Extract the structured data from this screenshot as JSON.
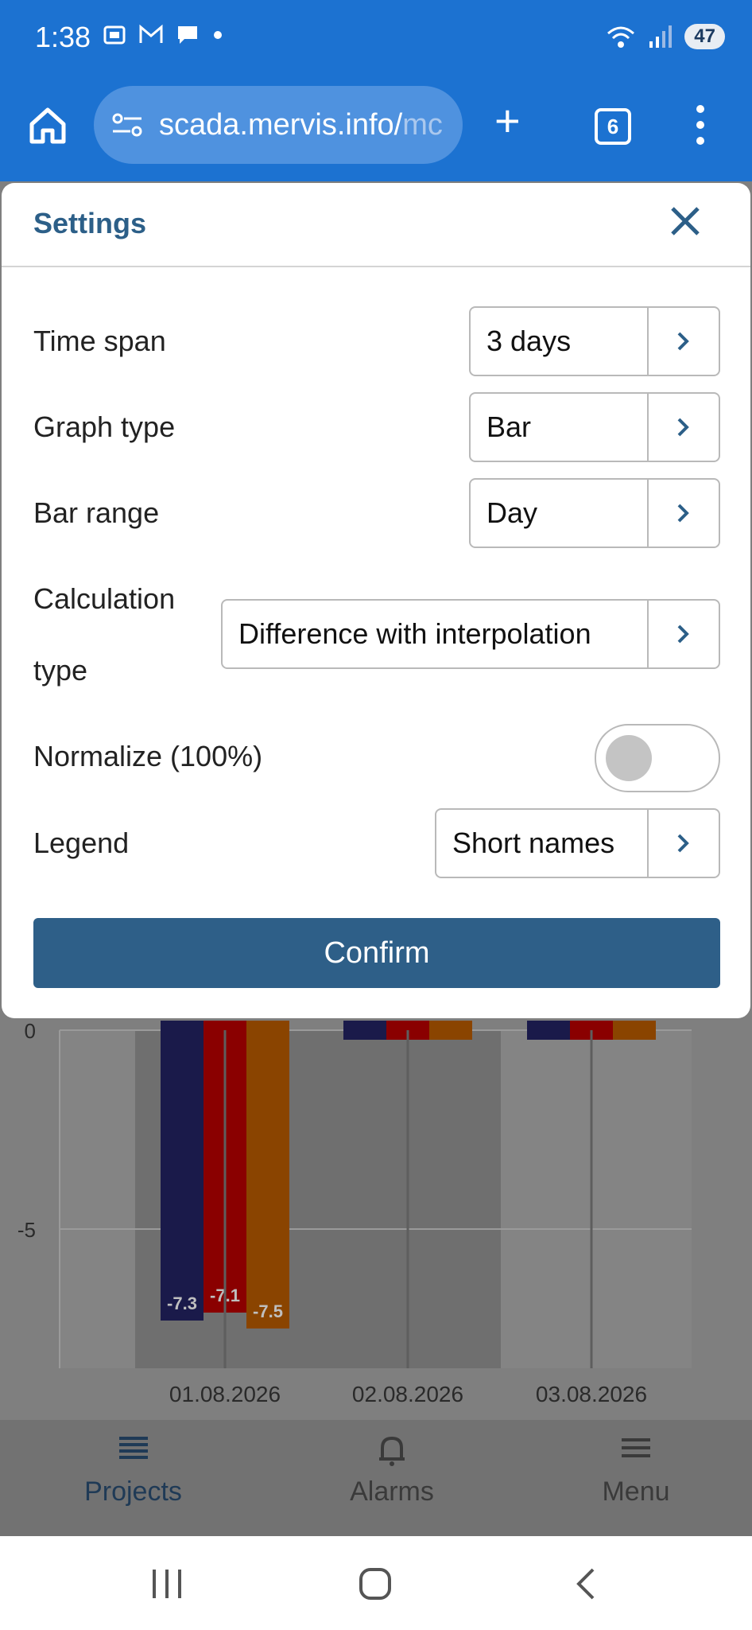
{
  "status_bar": {
    "time": "1:38",
    "battery": "47"
  },
  "browser": {
    "url_visible": "scada.mervis.info/",
    "url_faded": "mc",
    "tab_count": "6"
  },
  "dialog": {
    "title": "Settings",
    "rows": [
      {
        "label": "Time span",
        "value": "3 days"
      },
      {
        "label": "Graph type",
        "value": "Bar"
      },
      {
        "label": "Bar range",
        "value": "Day"
      },
      {
        "label_line1": "Calculation",
        "label_line2": "type",
        "value": "Difference with interpolation"
      },
      {
        "label": "Normalize (100%)",
        "toggle_on": false
      },
      {
        "label": "Legend",
        "value": "Short names"
      }
    ],
    "confirm_label": "Confirm"
  },
  "chart_data": {
    "type": "bar",
    "categories": [
      "01.08.2026",
      "02.08.2026",
      "03.08.2026"
    ],
    "series": [
      {
        "values": [
          -7.3,
          0,
          0
        ],
        "color": "#1a1a4a"
      },
      {
        "values": [
          -7.1,
          0,
          0
        ],
        "color": "#8a0000"
      },
      {
        "values": [
          -7.5,
          0,
          0
        ],
        "color": "#8a4400"
      }
    ],
    "y_ticks": [
      "0",
      "-5"
    ],
    "ylim": [
      -8.5,
      0
    ],
    "data_labels": [
      "-7.3",
      "-7.1",
      "-7.5"
    ]
  },
  "bottom_nav": {
    "items": [
      {
        "label": "Projects",
        "icon": "list-icon",
        "active": true
      },
      {
        "label": "Alarms",
        "icon": "bell-icon",
        "active": false
      },
      {
        "label": "Menu",
        "icon": "hamburger-icon",
        "active": false
      }
    ]
  }
}
